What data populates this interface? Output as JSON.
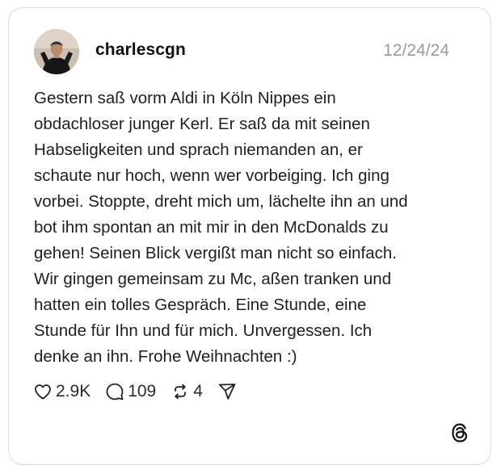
{
  "post": {
    "username": "charlescgn",
    "date": "12/24/24",
    "lines": [
      "Gestern saß vorm Aldi in Köln Nippes ein",
      "obdachloser junger Kerl. Er saß da mit seinen",
      "Habseligkeiten und sprach niemanden an, er",
      "schaute nur hoch, wenn wer vorbeiging. Ich ging",
      "vorbei. Stoppte, dreht mich um, lächelte ihn an und",
      "bot ihm spontan an mit mir in den McDonalds zu",
      "gehen! Seinen Blick vergißt man nicht so einfach.",
      "Wir gingen gemeinsam zu Mc, aßen tranken und",
      "hatten ein tolles Gespräch. Eine Stunde, eine",
      "Stunde für Ihn und für mich. Unvergessen. Ich",
      "denke an ihn. Frohe Weihnachten :)"
    ]
  },
  "actions": {
    "likes": "2.9K",
    "replies": "109",
    "reposts": "4"
  },
  "icons": {
    "like": "heart-icon",
    "reply": "speech-bubble-icon",
    "repost": "repost-icon",
    "share": "send-icon",
    "brand": "threads-logo-icon"
  },
  "colors": {
    "text": "#1f1f1f",
    "muted": "#9a9a9a",
    "border": "#d9d9d9"
  }
}
